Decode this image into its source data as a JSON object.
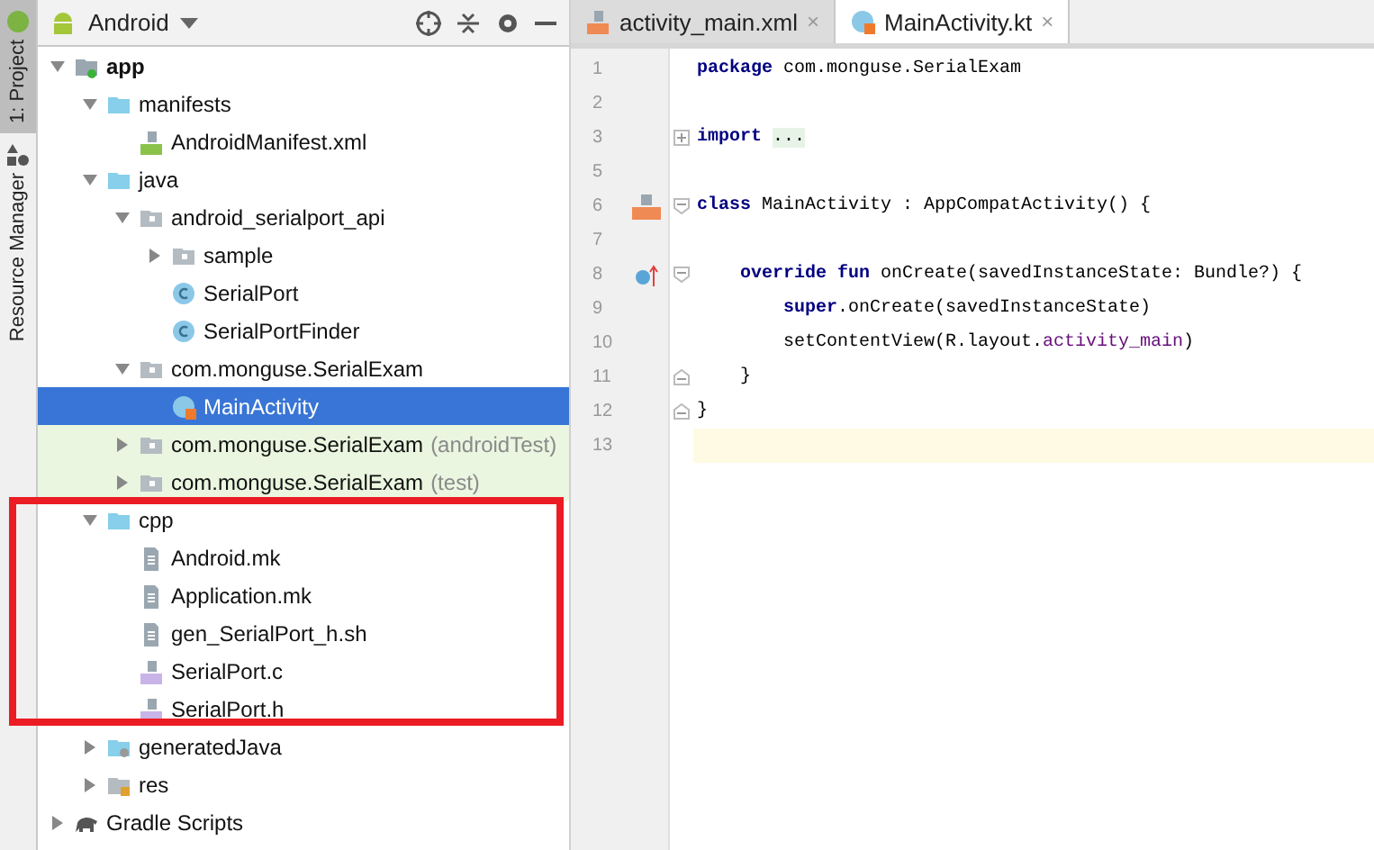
{
  "side_strip": [
    {
      "label": "1: Project",
      "selected": true
    },
    {
      "label": "Resource Manager",
      "selected": false
    }
  ],
  "project_panel": {
    "view": "Android"
  },
  "tree": [
    {
      "label": "app",
      "kind": "module",
      "expanded": true,
      "children": [
        {
          "label": "manifests",
          "kind": "folder",
          "expanded": true,
          "children": [
            {
              "label": "AndroidManifest.xml",
              "kind": "manifest"
            }
          ]
        },
        {
          "label": "java",
          "kind": "folder",
          "expanded": true,
          "children": [
            {
              "label": "android_serialport_api",
              "kind": "package",
              "expanded": true,
              "children": [
                {
                  "label": "sample",
                  "kind": "package",
                  "expanded": false
                },
                {
                  "label": "SerialPort",
                  "kind": "class"
                },
                {
                  "label": "SerialPortFinder",
                  "kind": "class"
                }
              ]
            },
            {
              "label": "com.monguse.SerialExam",
              "kind": "package",
              "expanded": true,
              "children": [
                {
                  "label": "MainActivity",
                  "kind": "kotlin",
                  "selected": true
                }
              ]
            },
            {
              "label": "com.monguse.SerialExam",
              "suffix": "(androidTest)",
              "kind": "package",
              "expanded": false,
              "test": true
            },
            {
              "label": "com.monguse.SerialExam",
              "suffix": "(test)",
              "kind": "package",
              "expanded": false,
              "test": true
            }
          ]
        },
        {
          "label": "cpp",
          "kind": "folder",
          "expanded": true,
          "highlighted": true,
          "children": [
            {
              "label": "Android.mk",
              "kind": "text"
            },
            {
              "label": "Application.mk",
              "kind": "text"
            },
            {
              "label": "gen_SerialPort_h.sh",
              "kind": "text"
            },
            {
              "label": "SerialPort.c",
              "kind": "cpp"
            },
            {
              "label": "SerialPort.h",
              "kind": "cpp"
            }
          ]
        },
        {
          "label": "generatedJava",
          "kind": "genfolder",
          "expanded": false
        },
        {
          "label": "res",
          "kind": "res",
          "expanded": false
        }
      ]
    },
    {
      "label": "Gradle Scripts",
      "kind": "gradle",
      "expanded": false
    }
  ],
  "editor_tabs": [
    {
      "label": "activity_main.xml",
      "kind": "layout",
      "selected": false,
      "close": "×"
    },
    {
      "label": "MainActivity.kt",
      "kind": "kotlin",
      "selected": true,
      "close": "×"
    }
  ],
  "code": [
    {
      "num": "1",
      "tokens": [
        {
          "kind": "kw",
          "text": "package"
        },
        {
          "kind": "plain",
          "text": " com.monguse.SerialExam"
        }
      ]
    },
    {
      "num": "2"
    },
    {
      "num": "3",
      "kind": "folded",
      "tokens": [
        {
          "kind": "kw",
          "text": "import "
        },
        {
          "kind": "folded",
          "text": "..."
        }
      ]
    },
    {
      "num": "5"
    },
    {
      "num": "6",
      "kind": "class",
      "tokens": [
        {
          "kind": "kw",
          "text": "class"
        },
        {
          "kind": "plain",
          "text": " MainActivity : AppCompatActivity() {"
        }
      ]
    },
    {
      "num": "7"
    },
    {
      "num": "8",
      "kind": "method",
      "tokens": [
        {
          "kind": "kw",
          "text": "    override fun"
        },
        {
          "kind": "plain",
          "text": " onCreate(savedInstanceState: Bundle?) {"
        }
      ]
    },
    {
      "num": "9",
      "tokens": [
        {
          "kind": "kw",
          "text": "        super"
        },
        {
          "kind": "plain",
          "text": ".onCreate(savedInstanceState)"
        }
      ]
    },
    {
      "num": "10",
      "tokens": [
        {
          "kind": "plain",
          "text": "        setContentView(R.layout."
        },
        {
          "kind": "field",
          "text": "activity_main"
        },
        {
          "kind": "plain",
          "text": ")"
        }
      ]
    },
    {
      "num": "11",
      "kind": "block_end",
      "tokens": [
        {
          "kind": "plain",
          "text": "    }"
        }
      ]
    },
    {
      "num": "12",
      "kind": "block_end",
      "tokens": [
        {
          "kind": "plain",
          "text": "}"
        }
      ]
    },
    {
      "num": "13",
      "current": true
    }
  ]
}
